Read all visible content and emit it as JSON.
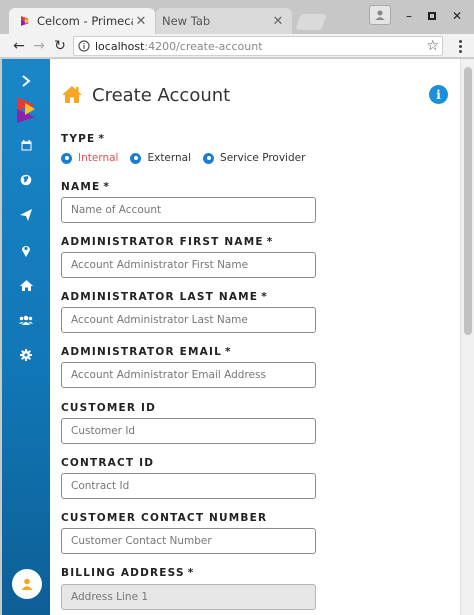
{
  "browser": {
    "tabs": [
      {
        "title": "Celcom - Primecast",
        "active": true
      },
      {
        "title": "New Tab",
        "active": false
      }
    ],
    "address": {
      "host": "localhost",
      "path": ":4200/create-account"
    }
  },
  "sidebar": {
    "items": [
      {
        "name": "expand",
        "icon": "chevron-right-icon"
      },
      {
        "name": "logo",
        "icon": "brand-logo-icon"
      },
      {
        "name": "calendar",
        "icon": "calendar-icon"
      },
      {
        "name": "globe",
        "icon": "globe-icon"
      },
      {
        "name": "send",
        "icon": "paper-plane-icon"
      },
      {
        "name": "location",
        "icon": "map-pin-icon"
      },
      {
        "name": "home",
        "icon": "home-icon"
      },
      {
        "name": "users",
        "icon": "users-icon"
      },
      {
        "name": "settings",
        "icon": "gear-icon"
      }
    ],
    "avatar_icon": "user-icon"
  },
  "page": {
    "title": "Create Account",
    "accent_color": "#f5a623",
    "info_label": "i"
  },
  "form": {
    "type": {
      "label": "TYPE",
      "required_mark": "*",
      "options": [
        "Internal",
        "External",
        "Service Provider"
      ],
      "selected": "Internal"
    },
    "fields": [
      {
        "key": "name",
        "label": "NAME",
        "required_mark": "*",
        "placeholder": "Name of Account"
      },
      {
        "key": "admin_first",
        "label": "ADMINISTRATOR FIRST NAME",
        "required_mark": "*",
        "placeholder": "Account Administrator First Name"
      },
      {
        "key": "admin_last",
        "label": "ADMINISTRATOR LAST NAME",
        "required_mark": "*",
        "placeholder": "Account Administrator Last Name"
      },
      {
        "key": "admin_email",
        "label": "ADMINISTRATOR EMAIL",
        "required_mark": "*",
        "placeholder": "Account Administrator Email Address"
      },
      {
        "key": "customer_id",
        "label": "CUSTOMER ID",
        "required_mark": "",
        "placeholder": "Customer Id"
      },
      {
        "key": "contract_id",
        "label": "CONTRACT ID",
        "required_mark": "",
        "placeholder": "Contract Id"
      },
      {
        "key": "contact_number",
        "label": "CUSTOMER CONTACT NUMBER",
        "required_mark": "",
        "placeholder": "Customer Contact Number"
      },
      {
        "key": "billing",
        "label": "BILLING ADDRESS",
        "required_mark": "*",
        "placeholder": "Address Line 1"
      }
    ]
  }
}
